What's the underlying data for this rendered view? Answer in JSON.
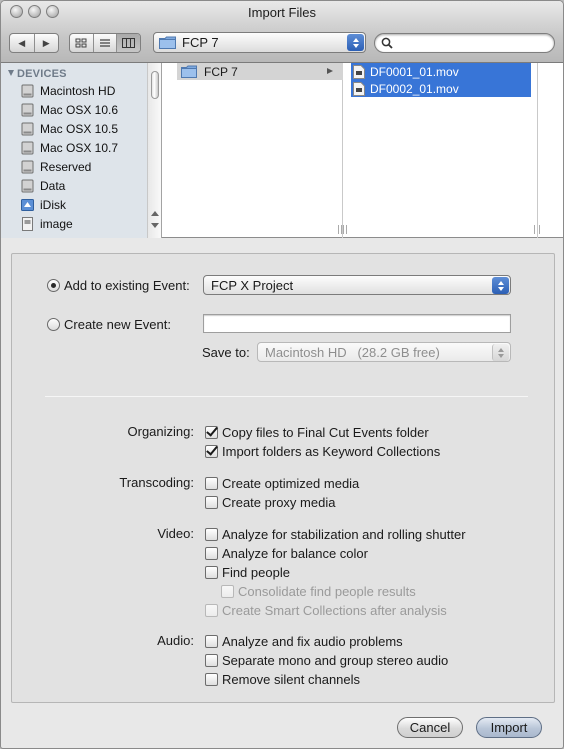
{
  "window": {
    "title": "Import Files"
  },
  "toolbar": {
    "path_popup_label": "FCP 7",
    "search_placeholder": "",
    "back_icon": "back-arrow-icon",
    "forward_icon": "forward-arrow-icon",
    "view_icons": [
      "icon-view-icon",
      "list-view-icon",
      "column-view-icon"
    ],
    "active_view": "column-view"
  },
  "sidebar": {
    "section_title": "DEVICES",
    "items": [
      {
        "label": "Macintosh HD",
        "icon": "hard-drive-icon"
      },
      {
        "label": "Mac OSX 10.6",
        "icon": "hard-drive-icon"
      },
      {
        "label": "Mac OSX 10.5",
        "icon": "hard-drive-icon"
      },
      {
        "label": "Mac OSX 10.7",
        "icon": "hard-drive-icon"
      },
      {
        "label": "Reserved",
        "icon": "hard-drive-icon"
      },
      {
        "label": "Data",
        "icon": "hard-drive-icon"
      },
      {
        "label": "iDisk",
        "icon": "idisk-icon"
      },
      {
        "label": "image",
        "icon": "disk-image-icon"
      }
    ]
  },
  "browser": {
    "column1": [
      {
        "label": "FCP 7",
        "selected": true,
        "has_children": true
      }
    ],
    "column2": [
      {
        "label": "DF0001_01.mov",
        "selected": true
      },
      {
        "label": "DF0002_01.mov",
        "selected": true
      }
    ]
  },
  "event": {
    "add_existing_label": "Add to existing Event:",
    "add_existing_selected": true,
    "existing_event_value": "FCP X Project",
    "create_new_label": "Create new Event:",
    "new_event_value": "",
    "save_to_label": "Save to:",
    "save_to_value": "Macintosh HD   (28.2 GB free)"
  },
  "organizing": {
    "label": "Organizing:",
    "options": [
      {
        "label": "Copy files to Final Cut Events folder",
        "checked": true,
        "enabled": true
      },
      {
        "label": "Import folders as Keyword Collections",
        "checked": true,
        "enabled": true
      }
    ]
  },
  "transcoding": {
    "label": "Transcoding:",
    "options": [
      {
        "label": "Create optimized media",
        "checked": false,
        "enabled": true
      },
      {
        "label": "Create proxy media",
        "checked": false,
        "enabled": true
      }
    ]
  },
  "video": {
    "label": "Video:",
    "options": [
      {
        "label": "Analyze for stabilization and rolling shutter",
        "checked": false,
        "enabled": true
      },
      {
        "label": "Analyze for balance color",
        "checked": false,
        "enabled": true
      },
      {
        "label": "Find people",
        "checked": false,
        "enabled": true
      },
      {
        "label": "Consolidate find people results",
        "checked": false,
        "enabled": false
      },
      {
        "label": "Create Smart Collections after analysis",
        "checked": false,
        "enabled": false
      }
    ]
  },
  "audio": {
    "label": "Audio:",
    "options": [
      {
        "label": "Analyze and fix audio problems",
        "checked": false,
        "enabled": true
      },
      {
        "label": "Separate mono and group stereo audio",
        "checked": false,
        "enabled": true
      },
      {
        "label": "Remove silent channels",
        "checked": false,
        "enabled": true
      }
    ]
  },
  "buttons": {
    "cancel": "Cancel",
    "import": "Import"
  },
  "colors": {
    "selection": "#3875d7",
    "sidebar_bg": "#dee4ea",
    "panel_bg": "#e2e2e2"
  }
}
